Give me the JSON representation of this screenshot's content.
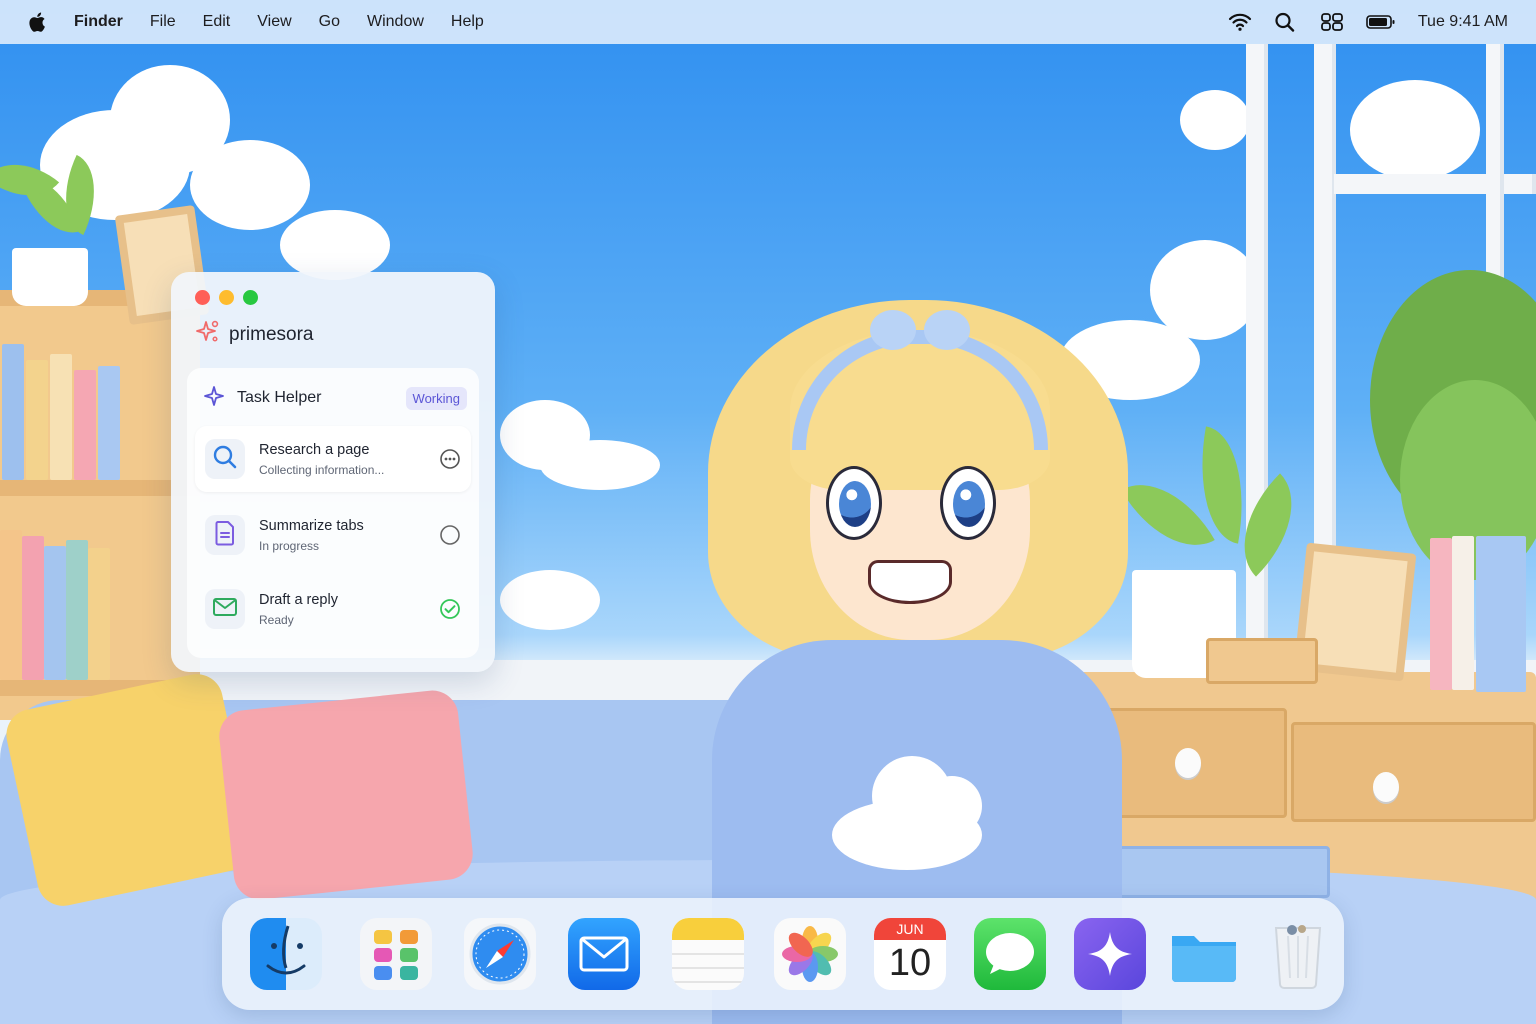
{
  "menubar": {
    "app_name": "Finder",
    "items": [
      "File",
      "Edit",
      "View",
      "Go",
      "Window",
      "Help"
    ],
    "clock": "Tue 9:41 AM",
    "icons": [
      "apple-icon",
      "wifi-icon",
      "search-icon",
      "control-center-icon",
      "battery-icon"
    ]
  },
  "assistant": {
    "brand": "primesora",
    "panel_title": "Task Helper",
    "status_badge": "Working",
    "tasks": [
      {
        "title": "Research a page",
        "subtitle": "Collecting information...",
        "icon": "search-icon",
        "status": "in-progress-dots"
      },
      {
        "title": "Summarize tabs",
        "subtitle": "In progress",
        "icon": "document-icon",
        "status": "pending-circle"
      },
      {
        "title": "Draft a reply",
        "subtitle": "Ready",
        "icon": "mail-icon",
        "status": "done-check"
      }
    ],
    "colors": {
      "accent": "#5b55d6",
      "close": "#ff5f57",
      "minimize": "#febc2e",
      "zoom": "#28c840",
      "done": "#34c759",
      "brand": "#f06a6a"
    }
  },
  "dock": {
    "apps": [
      "Finder",
      "Launchpad",
      "Safari",
      "Mail",
      "Notes",
      "Photos",
      "Calendar",
      "Messages",
      "Assistant",
      "Files",
      "Trash"
    ],
    "calendar": {
      "month": "JUN",
      "day": "10"
    }
  }
}
